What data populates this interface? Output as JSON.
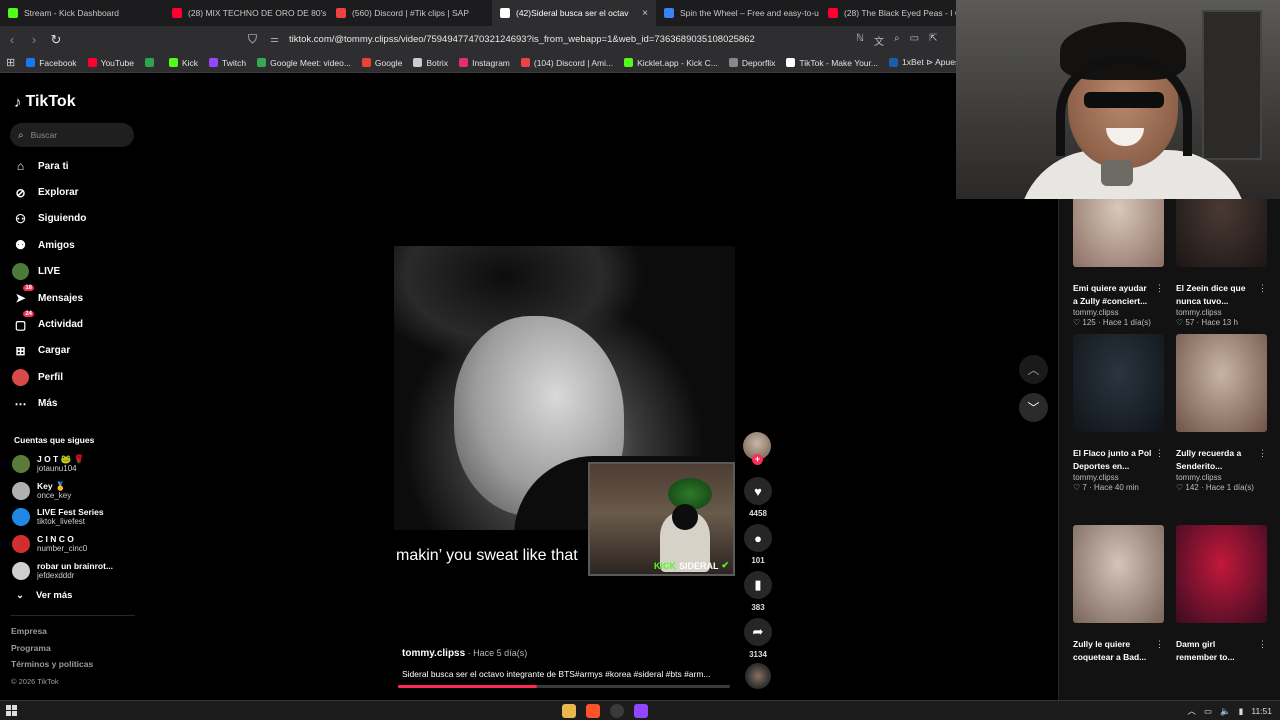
{
  "browser": {
    "tabs": [
      {
        "title": "Stream - Kick Dashboard",
        "color": "#53fc18",
        "active": false
      },
      {
        "title": "(28) MIX TECHNO DE ORO DE 80's & ...",
        "color": "#ff0033",
        "active": false
      },
      {
        "title": "(560) Discord | #Tik clips | SAP",
        "color": "#ed4245",
        "active": false
      },
      {
        "title": "(42)Sideral busca ser el octav",
        "color": "#ffffff",
        "active": true
      },
      {
        "title": "Spin the Wheel – Free and easy-to-u",
        "color": "#3b82f6",
        "active": false
      },
      {
        "title": "(28) The Black Eyed Peas - I Gotta",
        "color": "#ff0033",
        "active": false
      }
    ],
    "url": "tiktok.com/@tommy.clipss/video/7594947747032124693?is_from_webapp=1&web_id=7363689035108025862",
    "bookmarks": [
      {
        "label": "Facebook",
        "color": "#1877f2"
      },
      {
        "label": "YouTube",
        "color": "#ff0033"
      },
      {
        "label": "",
        "color": "#2ea44f"
      },
      {
        "label": "Kick",
        "color": "#53fc18"
      },
      {
        "label": "Twitch",
        "color": "#9146ff"
      },
      {
        "label": "Google Meet: video...",
        "color": "#34a853"
      },
      {
        "label": "Google",
        "color": "#ea4335"
      },
      {
        "label": "Botrix",
        "color": "#cccccc"
      },
      {
        "label": "Instagram",
        "color": "#e1306c"
      },
      {
        "label": "(104) Discord | Ami...",
        "color": "#ed4245"
      },
      {
        "label": "Kicklet.app - Kick C...",
        "color": "#53fc18"
      },
      {
        "label": "Deporflix",
        "color": "#888888"
      },
      {
        "label": "TikTok - Make Your...",
        "color": "#ffffff"
      },
      {
        "label": "1xBet ⊳ Apues",
        "color": "#1a5dab"
      }
    ]
  },
  "sidebar": {
    "brand": "TikTok",
    "search_placeholder": "Buscar",
    "nav": [
      {
        "label": "Para ti",
        "icon": "home-icon",
        "glyph": "⌂",
        "badge": ""
      },
      {
        "label": "Explorar",
        "icon": "compass-icon",
        "glyph": "⊘",
        "badge": ""
      },
      {
        "label": "Siguiendo",
        "icon": "following-icon",
        "glyph": "⚇",
        "badge": ""
      },
      {
        "label": "Amigos",
        "icon": "friends-icon",
        "glyph": "⚉",
        "badge": ""
      },
      {
        "label": "LIVE",
        "icon": "live-icon",
        "glyph": "●",
        "badge": ""
      },
      {
        "label": "Mensajes",
        "icon": "messages-icon",
        "glyph": "➤",
        "badge": "18"
      },
      {
        "label": "Actividad",
        "icon": "activity-icon",
        "glyph": "▢",
        "badge": "24"
      },
      {
        "label": "Cargar",
        "icon": "upload-icon",
        "glyph": "⊞",
        "badge": ""
      },
      {
        "label": "Perfil",
        "icon": "profile-icon",
        "glyph": "●",
        "badge": ""
      },
      {
        "label": "Más",
        "icon": "more-icon",
        "glyph": "⋯",
        "badge": ""
      }
    ],
    "following_title": "Cuentas que sigues",
    "following": [
      {
        "name": "J O T 🐸 🌹",
        "handle": "jotaunu104",
        "color": "#5c7a3a"
      },
      {
        "name": "Key 🥇",
        "handle": "once_key",
        "color": "#b0b0b0"
      },
      {
        "name": "LIVE Fest Series",
        "handle": "tiktok_livefest",
        "color": "#1e88e5"
      },
      {
        "name": "C I N C O",
        "handle": "number_cinc0",
        "color": "#d32f2f"
      },
      {
        "name": "robar un brainrot...",
        "handle": "jefdexdddr",
        "color": "#cfcfcf"
      }
    ],
    "see_more": "Ver más",
    "footer_links": [
      "Empresa",
      "Programa",
      "Términos y políticas"
    ],
    "copyright": "© 2026 TikTok"
  },
  "video": {
    "subtitle": "makin’ you sweat like that",
    "pip_brand": "KICK",
    "pip_channel": "SIDERAL",
    "author": "tommy.clipss",
    "time": " · Hace 5 día(s)",
    "caption": "Sideral busca ser el octavo integrante de BTS#armys #korea #sideral #bts #arm...",
    "progress_percent": 42,
    "likes": "4458",
    "comments": "101",
    "saves": "383",
    "shares": "3134"
  },
  "recommended": [
    {
      "title": "Emi quiere ayudar a Zully #conciert...",
      "author": "tommy.clipss",
      "likes": "125",
      "time": "Hace 1 día(s)",
      "c1": "#d9c8bd",
      "c2": "#8c6f63"
    },
    {
      "title": "El Zeein dice que nunca tuvo...",
      "author": "tommy.clipss",
      "likes": "57",
      "time": "Hace 13 h",
      "c1": "#4a3a34",
      "c2": "#1b1616"
    },
    {
      "title": "El Flaco junto a Pol Deportes en...",
      "author": "tommy.clipss",
      "likes": "7",
      "time": "Hace 40 min",
      "c1": "#2b3540",
      "c2": "#0f1418"
    },
    {
      "title": "Zully recuerda a Senderito...",
      "author": "tommy.clipss",
      "likes": "142",
      "time": "Hace 1 día(s)",
      "c1": "#c9b4a4",
      "c2": "#6e5447"
    },
    {
      "title": "Zully le quiere coquetear a Bad...",
      "author": "",
      "likes": "",
      "time": "",
      "c1": "#d4c4ba",
      "c2": "#7a6459"
    },
    {
      "title": "Damn girl remember to...",
      "author": "",
      "likes": "",
      "time": "",
      "c1": "#c2183a",
      "c2": "#3a0c22"
    }
  ],
  "taskbar": {
    "time": "11:51"
  },
  "colors": {
    "accent": "#fe2c55",
    "kick": "#53fc18"
  }
}
